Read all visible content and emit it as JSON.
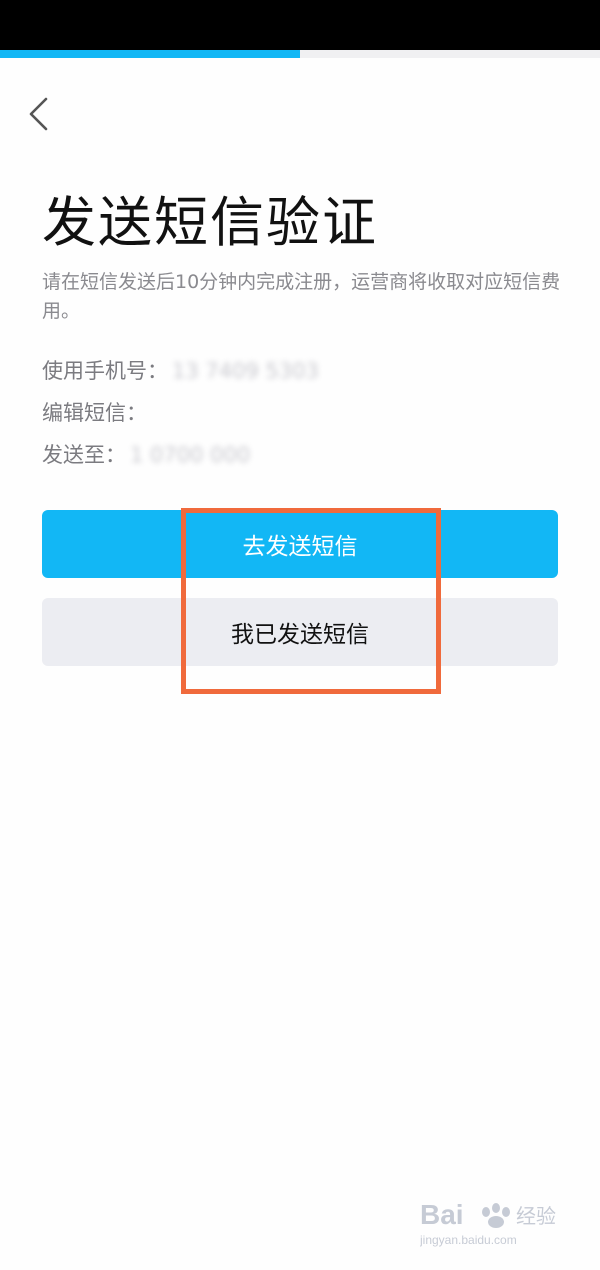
{
  "header": {
    "progress_fraction": 0.5
  },
  "page": {
    "title": "发送短信验证",
    "description": "请在短信发送后10分钟内完成注册，运营商将收取对应短信费用。"
  },
  "info": {
    "phone_label": "使用手机号：",
    "phone_value": "13  7409 5303",
    "content_label": "编辑短信：",
    "content_value": "",
    "sendto_label": "发送至：",
    "sendto_value": "1    0700 000"
  },
  "buttons": {
    "send_label": "去发送短信",
    "sent_label": "我已发送短信"
  },
  "watermark": {
    "brand": "Bai",
    "brand_suffix": "经验",
    "url": "jingyan.baidu.com"
  },
  "colors": {
    "accent": "#12b7f5",
    "highlight": "#f06a3c",
    "secondary_bg": "#ecedf2"
  }
}
